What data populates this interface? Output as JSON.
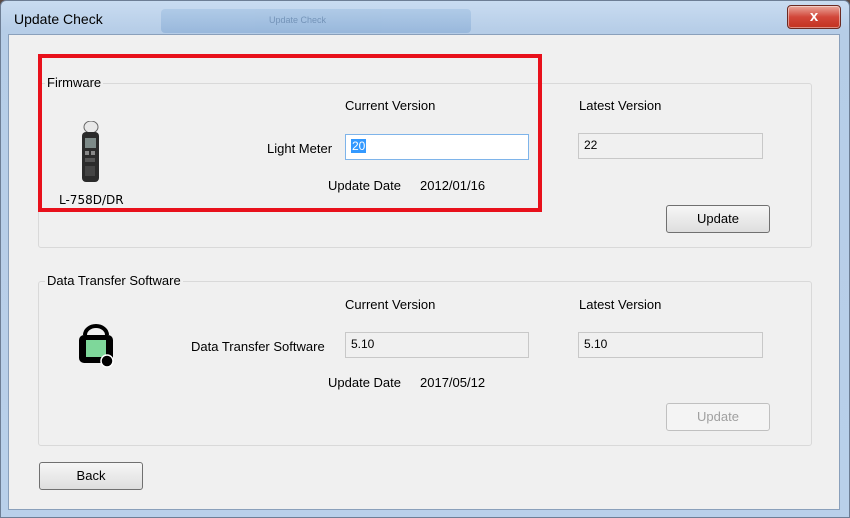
{
  "window": {
    "title": "Update Check",
    "title_overlay": "Update Check",
    "close_symbol": "x"
  },
  "firmware": {
    "group_label": "Firmware",
    "current_version_header": "Current Version",
    "latest_version_header": "Latest Version",
    "device_icon": "light-meter-icon",
    "device_name": "L-758D/DR",
    "row_label": "Light Meter",
    "current_version": "20",
    "latest_version": "22",
    "update_date_label": "Update Date",
    "update_date": "2012/01/16",
    "update_button": "Update"
  },
  "software": {
    "group_label": "Data Transfer Software",
    "current_version_header": "Current Version",
    "latest_version_header": "Latest Version",
    "device_icon": "data-transfer-icon",
    "row_label": "Data Transfer Software",
    "current_version": "5.10",
    "latest_version": "5.10",
    "update_date_label": "Update Date",
    "update_date": "2017/05/12",
    "update_button": "Update"
  },
  "back_button": "Back",
  "colors": {
    "highlight": "#e8101b",
    "selection": "#3399ff"
  }
}
